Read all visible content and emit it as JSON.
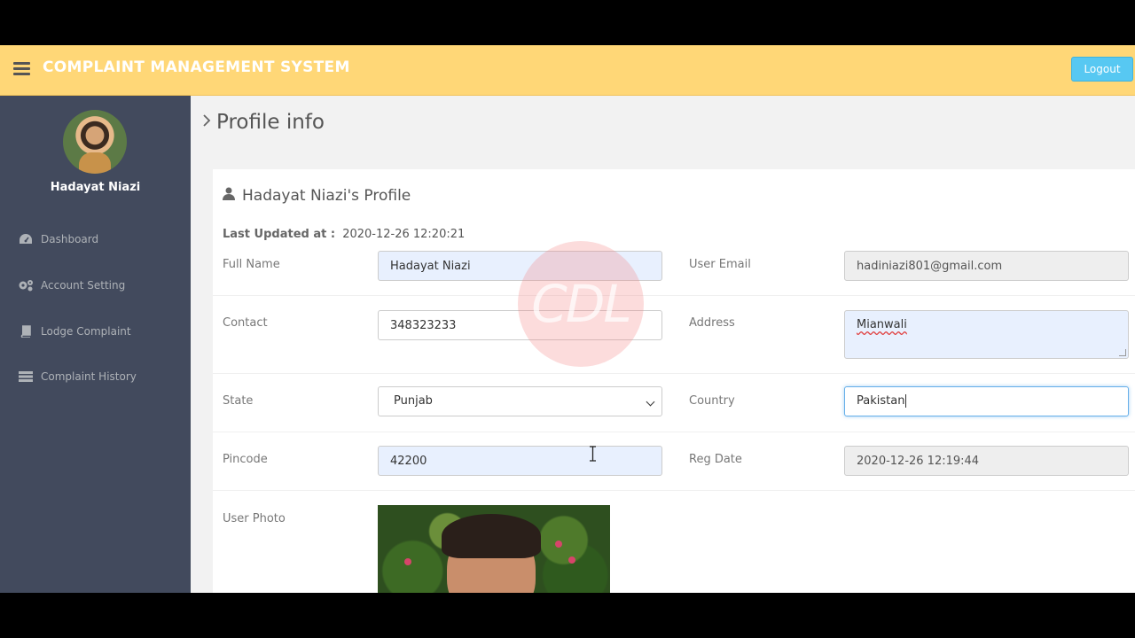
{
  "header": {
    "title": "COMPLAINT MANAGEMENT SYSTEM",
    "logout_label": "Logout"
  },
  "sidebar": {
    "user_name": "Hadayat Niazi",
    "items": [
      {
        "label": "Dashboard",
        "icon": "dashboard-icon"
      },
      {
        "label": "Account Setting",
        "icon": "cogs-icon"
      },
      {
        "label": "Lodge Complaint",
        "icon": "book-icon"
      },
      {
        "label": "Complaint History",
        "icon": "list-icon"
      }
    ]
  },
  "page": {
    "title": "Profile info"
  },
  "profile": {
    "heading": "Hadayat Niazi's Profile",
    "last_updated_label": "Last Updated at :",
    "last_updated_value": "2020-12-26 12:20:21",
    "fields": {
      "full_name": {
        "label": "Full Name",
        "value": "Hadayat Niazi"
      },
      "user_email": {
        "label": "User Email",
        "value": "hadiniazi801@gmail.com"
      },
      "contact": {
        "label": "Contact",
        "value": "348323233"
      },
      "address": {
        "label": "Address",
        "value": "Mianwali"
      },
      "state": {
        "label": "State",
        "value": "Punjab"
      },
      "country": {
        "label": "Country",
        "value": "Pakistan"
      },
      "pincode": {
        "label": "Pincode",
        "value": "42200"
      },
      "reg_date": {
        "label": "Reg Date",
        "value": "2020-12-26 12:19:44"
      },
      "user_photo": {
        "label": "User Photo"
      }
    }
  },
  "watermark": {
    "text": "CDL"
  },
  "colors": {
    "header_bg": "#ffd777",
    "sidebar_bg": "#424a5d",
    "logout_bg": "#57c8f2",
    "autofill_bg": "#e8f0fe"
  }
}
